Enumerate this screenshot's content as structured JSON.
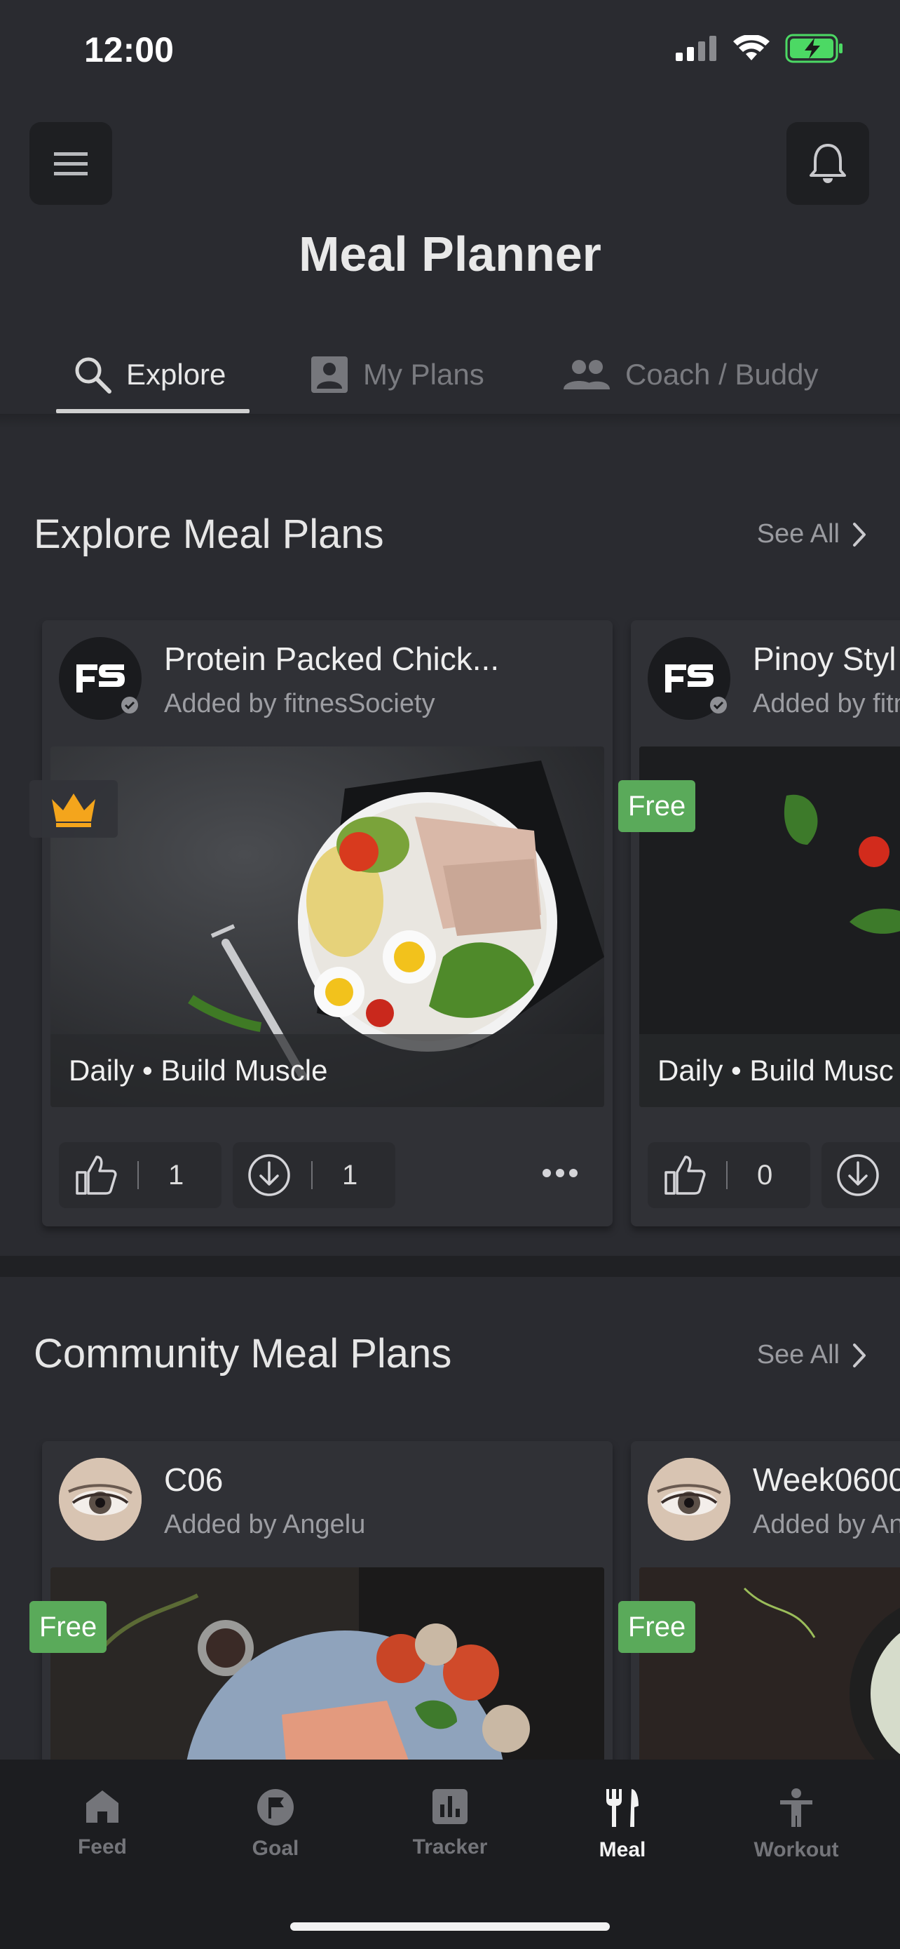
{
  "status": {
    "time": "12:00"
  },
  "header": {
    "title": "Meal Planner"
  },
  "tabs": [
    {
      "label": "Explore",
      "icon": "search-icon",
      "active": true
    },
    {
      "label": "My Plans",
      "icon": "person-card-icon",
      "active": false
    },
    {
      "label": "Coach / Buddy",
      "icon": "people-icon",
      "active": false
    }
  ],
  "explore": {
    "title": "Explore Meal Plans",
    "see_all": "See All",
    "cards": [
      {
        "name": "Protein Packed Chick...",
        "added_by": "Added by fitnesSociety",
        "badge": "crown",
        "tags": "Daily • Build Muscle",
        "likes": "1",
        "downloads": "1"
      },
      {
        "name": "Pinoy Styl",
        "added_by": "Added by fitn",
        "badge": "Free",
        "tags": "Daily • Build Musc",
        "likes": "0"
      }
    ]
  },
  "community": {
    "title": "Community Meal Plans",
    "see_all": "See All",
    "cards": [
      {
        "name": "C06",
        "added_by": "Added by Angelu",
        "badge": "Free"
      },
      {
        "name": "Week0600",
        "added_by": "Added by An",
        "badge": "Free"
      }
    ]
  },
  "bottom_nav": [
    {
      "label": "Feed",
      "icon": "home-icon",
      "active": false
    },
    {
      "label": "Goal",
      "icon": "flag-icon",
      "active": false
    },
    {
      "label": "Tracker",
      "icon": "chart-icon",
      "active": false
    },
    {
      "label": "Meal",
      "icon": "fork-knife-icon",
      "active": true
    },
    {
      "label": "Workout",
      "icon": "person-icon",
      "active": false
    }
  ],
  "colors": {
    "background": "#2a2b30",
    "card": "#303136",
    "free_badge": "#5aaa5a",
    "crown": "#f4a51c",
    "battery": "#4cd964"
  }
}
